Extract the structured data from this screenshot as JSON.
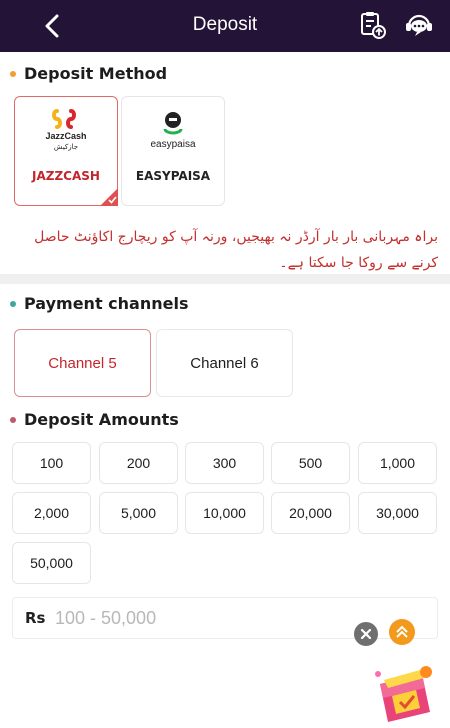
{
  "header": {
    "title": "Deposit"
  },
  "deposit_method": {
    "title": "Deposit Method",
    "methods": [
      {
        "label": "JAZZCASH",
        "logo_text": "JazzCash",
        "logo_subtext": "جازکیش",
        "selected": true
      },
      {
        "label": "EASYPAISA",
        "logo_text": "easypaisa",
        "selected": false
      }
    ]
  },
  "notice": "براہ مہربانی بار بار آرڈر نہ بھیجیں، ورنہ آپ کو ریچارج اکاؤنٹ حاصل کرنے سے روکا جا سکتا ہے۔",
  "payment_channels": {
    "title": "Payment channels",
    "channels": [
      {
        "label": "Channel 5",
        "selected": true
      },
      {
        "label": "Channel 6",
        "selected": false
      }
    ]
  },
  "deposit_amounts": {
    "title": "Deposit Amounts",
    "amounts": [
      "100",
      "200",
      "300",
      "500",
      "1,000",
      "2,000",
      "5,000",
      "10,000",
      "20,000",
      "30,000",
      "50,000"
    ]
  },
  "amount_input": {
    "currency": "Rs",
    "placeholder": "100 - 50,000",
    "value": ""
  },
  "colors": {
    "header_bg": "#231336",
    "accent_red": "#c4262c",
    "dot_orange": "#f0a030",
    "dot_teal": "#3aa8a0",
    "dot_rose": "#c05a6a",
    "top_button": "#f39a1d"
  },
  "icons": [
    "back-arrow-icon",
    "deposit-record-icon",
    "customer-service-icon",
    "check-icon",
    "close-icon",
    "double-chevron-up-icon",
    "gift-chest-icon"
  ]
}
